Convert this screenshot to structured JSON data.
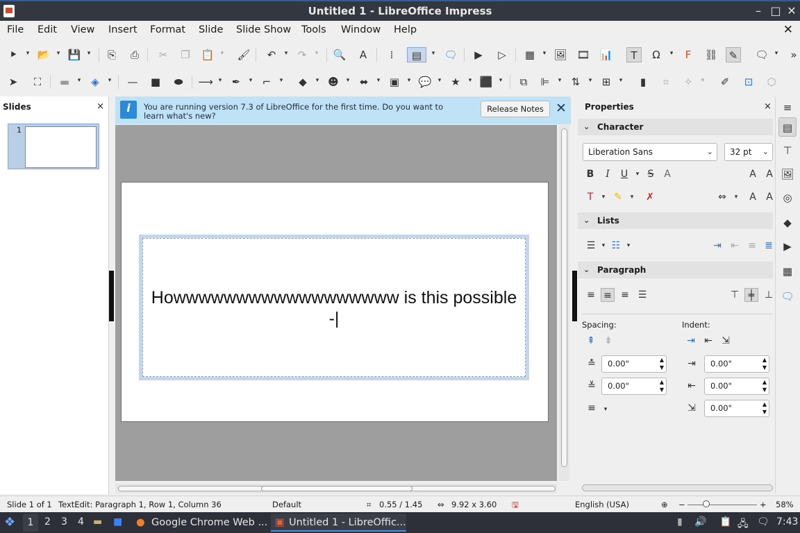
{
  "window": {
    "title": "Untitled 1 - LibreOffice Impress",
    "min": "–",
    "max": "□",
    "close": "✕"
  },
  "menu": [
    "File",
    "Edit",
    "View",
    "Insert",
    "Format",
    "Slide",
    "Slide Show",
    "Tools",
    "Window",
    "Help"
  ],
  "slides_pane": {
    "title": "Slides",
    "close": "×",
    "thumb_number": "1"
  },
  "infobar": {
    "message": "You are running version 7.3 of LibreOffice for the first time. Do you want to learn what's new?",
    "button": "Release Notes",
    "close": "✕"
  },
  "slide": {
    "text_line1": "Howwwwwwwwwwwwwwwwww is this possible",
    "text_line2": "-|"
  },
  "properties": {
    "title": "Properties",
    "close": "×",
    "sections": {
      "character": "Character",
      "lists": "Lists",
      "paragraph": "Paragraph"
    },
    "font_name": "Liberation Sans",
    "font_size": "32 pt",
    "spacing_label": "Spacing:",
    "indent_label": "Indent:",
    "above_spacing": "0.00\"",
    "below_spacing": "0.00\"",
    "before_indent": "0.00\"",
    "after_indent": "0.00\"",
    "first_line_indent": "0.00\""
  },
  "status": {
    "slide": "Slide 1 of 1",
    "edit": "TextEdit: Paragraph 1, Row 1, Column 36",
    "layout": "Default",
    "position": "0.55 / 1.45",
    "size": "9.92 x 3.60",
    "language": "English (USA)",
    "zoom": "58%"
  },
  "taskbar": {
    "workspaces": [
      "1",
      "2",
      "3",
      "4"
    ],
    "windows": [
      {
        "label": "Google Chrome Web ..."
      },
      {
        "label": "Untitled 1 - LibreOffic..."
      }
    ],
    "time": "7:43"
  }
}
